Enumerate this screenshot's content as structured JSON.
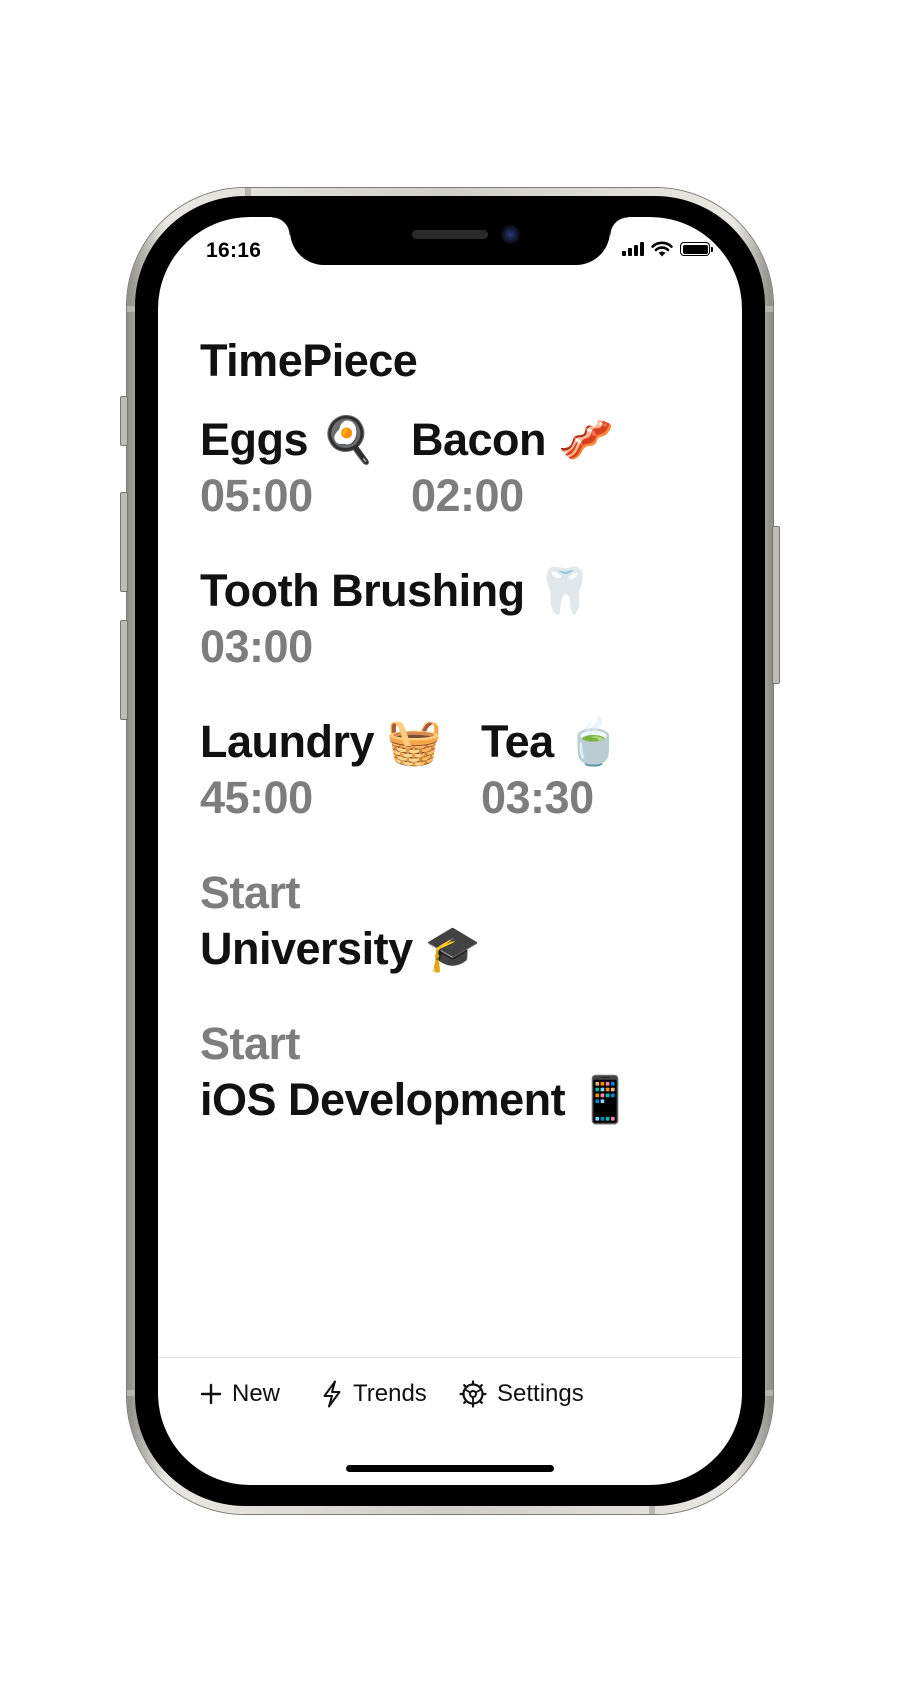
{
  "status_bar": {
    "time": "16:16"
  },
  "app": {
    "title": "TimePiece"
  },
  "timers": [
    {
      "name": "Eggs",
      "emoji": "🍳",
      "time": "05:00"
    },
    {
      "name": "Bacon",
      "emoji": "🥓",
      "time": "02:00"
    },
    {
      "name": "Tooth Brushing",
      "emoji": "🦷",
      "time": "03:00"
    },
    {
      "name": "Laundry",
      "emoji": "🧺",
      "time": "45:00"
    },
    {
      "name": "Tea",
      "emoji": "🍵",
      "time": "03:30"
    }
  ],
  "start_items": [
    {
      "label": "Start",
      "name": "University",
      "emoji": "🎓"
    },
    {
      "label": "Start",
      "name": "iOS Development",
      "emoji": "📱"
    }
  ],
  "tabbar": {
    "new": {
      "label": "New",
      "icon": "plus-icon"
    },
    "trends": {
      "label": "Trends",
      "icon": "bolt-icon"
    },
    "settings": {
      "label": "Settings",
      "icon": "gear-icon"
    }
  },
  "colors": {
    "text": "#111111",
    "secondary": "#7d7d7d",
    "background": "#ffffff"
  }
}
